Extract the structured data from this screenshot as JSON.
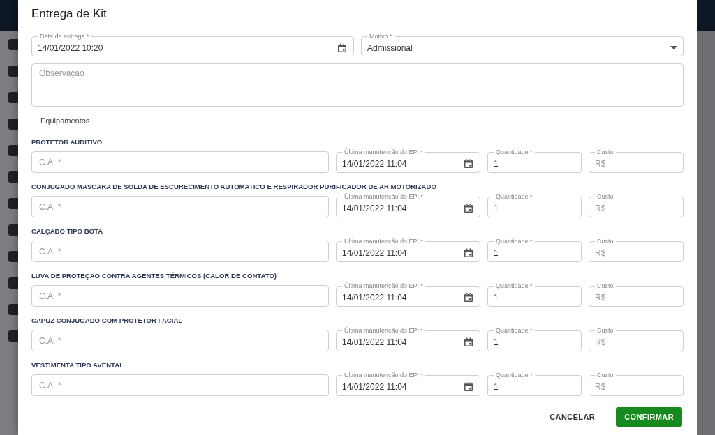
{
  "dialog": {
    "title": "Entrega de Kit",
    "delivery_date": {
      "label": "Data de entrega *",
      "value": "14/01/2022 10:20"
    },
    "reason": {
      "label": "Motivo *",
      "value": "Admissional"
    },
    "notes": {
      "placeholder": "Observação"
    },
    "section_title": "Equipamentos",
    "items": [
      {
        "name": "PROTETOR AUDITIVO",
        "ca": {
          "placeholder": "C.A. *"
        },
        "maintenance": {
          "label": "Última manutenção do EPI *",
          "value": "14/01/2022 11:04"
        },
        "quantity": {
          "label": "Quantidade *",
          "value": "1"
        },
        "cost": {
          "label": "Custo",
          "placeholder": "R$"
        }
      },
      {
        "name": "CONJUGADO MASCARA DE SOLDA DE ESCURECIMENTO AUTOMATICO E RESPIRADOR PURIFICADOR DE AR MOTORIZADO",
        "ca": {
          "placeholder": "C.A. *"
        },
        "maintenance": {
          "label": "Última manutenção do EPI *",
          "value": "14/01/2022 11:04"
        },
        "quantity": {
          "label": "Quantidade *",
          "value": "1"
        },
        "cost": {
          "label": "Custo",
          "placeholder": "R$"
        }
      },
      {
        "name": "CALÇADO TIPO BOTA",
        "ca": {
          "placeholder": "C.A. *"
        },
        "maintenance": {
          "label": "Última manutenção do EPI *",
          "value": "14/01/2022 11:04"
        },
        "quantity": {
          "label": "Quantidade *",
          "value": "1"
        },
        "cost": {
          "label": "Custo",
          "placeholder": "R$"
        }
      },
      {
        "name": "LUVA DE PROTEÇÃO CONTRA AGENTES TÉRMICOS (CALOR DE CONTATO)",
        "ca": {
          "placeholder": "C.A. *"
        },
        "maintenance": {
          "label": "Última manutenção do EPI *",
          "value": "14/01/2022 11:04"
        },
        "quantity": {
          "label": "Quantidade *",
          "value": "1"
        },
        "cost": {
          "label": "Custo",
          "placeholder": "R$"
        }
      },
      {
        "name": "CAPUZ CONJUGADO COM PROTETOR FACIAL",
        "ca": {
          "placeholder": "C.A. *"
        },
        "maintenance": {
          "label": "Última manutenção do EPI *",
          "value": "14/01/2022 11:04"
        },
        "quantity": {
          "label": "Quantidade *",
          "value": "1"
        },
        "cost": {
          "label": "Custo",
          "placeholder": "R$"
        }
      },
      {
        "name": "VESTIMENTA TIPO AVENTAL",
        "ca": {
          "placeholder": "C.A. *"
        },
        "maintenance": {
          "label": "Última manutenção do EPI *",
          "value": "14/01/2022 11:04"
        },
        "quantity": {
          "label": "Quantidade *",
          "value": "1"
        },
        "cost": {
          "label": "Custo",
          "placeholder": "R$"
        }
      }
    ],
    "buttons": [
      {
        "label": "CANCELAR",
        "kind": "text"
      },
      {
        "label": "CONFIRMAR",
        "kind": "primary"
      }
    ]
  }
}
